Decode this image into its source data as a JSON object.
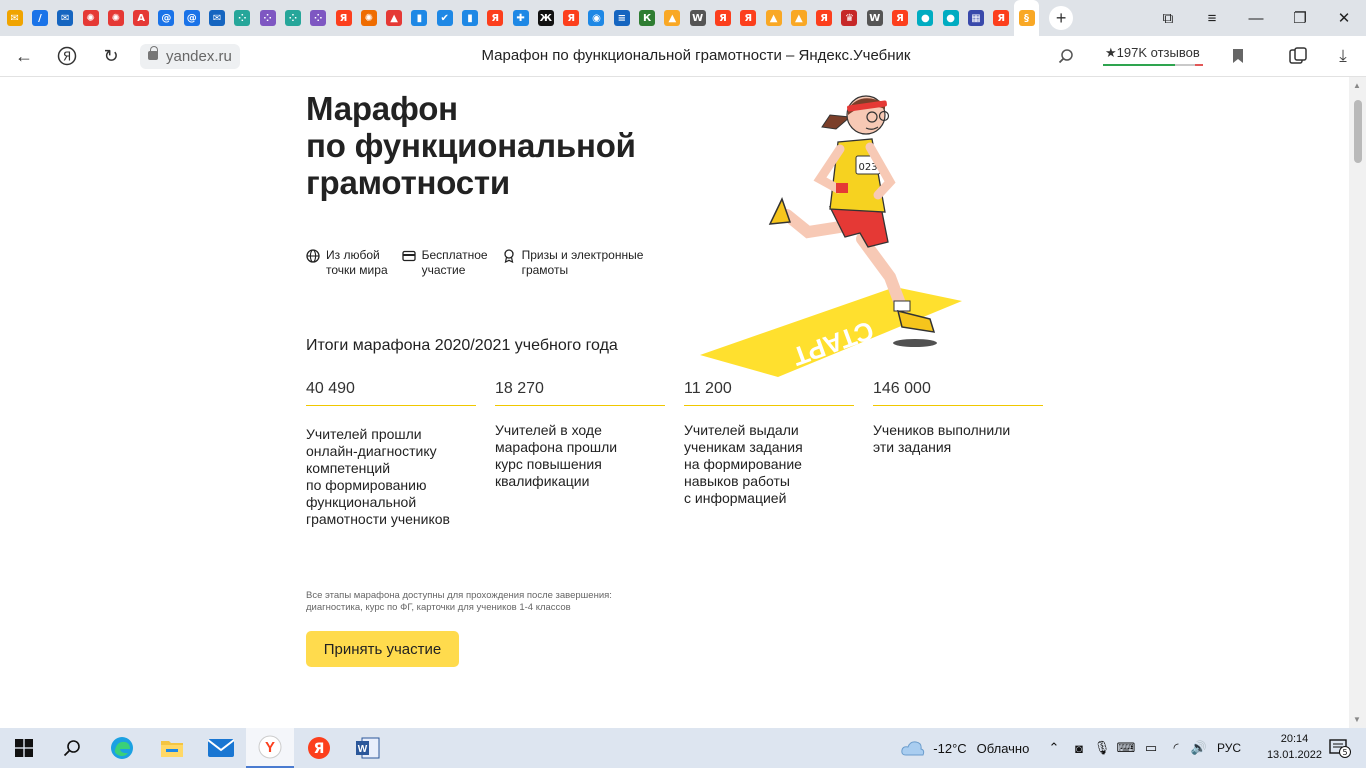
{
  "browser": {
    "tabs": [
      {
        "icon": "mail-icon",
        "color": "#f0a400",
        "glyph": "✉"
      },
      {
        "icon": "edit-icon",
        "color": "#1a73e8",
        "glyph": "/"
      },
      {
        "icon": "mail-icon",
        "color": "#1565c0",
        "glyph": "✉"
      },
      {
        "icon": "ornament-icon",
        "color": "#e53935",
        "glyph": "✺"
      },
      {
        "icon": "ornament-icon",
        "color": "#e53935",
        "glyph": "✺"
      },
      {
        "icon": "pdf-icon",
        "color": "#e53935",
        "glyph": "A"
      },
      {
        "icon": "at-icon",
        "color": "#1a73e8",
        "glyph": "@"
      },
      {
        "icon": "at-icon",
        "color": "#1a73e8",
        "glyph": "@"
      },
      {
        "icon": "mail-icon",
        "color": "#1565c0",
        "glyph": "✉"
      },
      {
        "icon": "dots-icon",
        "color": "#26a69a",
        "glyph": "⁘"
      },
      {
        "icon": "dots-icon",
        "color": "#7e57c2",
        "glyph": "⁘"
      },
      {
        "icon": "dots-icon",
        "color": "#26a69a",
        "glyph": "⁘"
      },
      {
        "icon": "dots-icon",
        "color": "#7e57c2",
        "glyph": "⁘"
      },
      {
        "icon": "yandex-icon",
        "color": "#fc3f1d",
        "glyph": "Я"
      },
      {
        "icon": "ornament-icon",
        "color": "#ef6c00",
        "glyph": "✺"
      },
      {
        "icon": "rocket-icon",
        "color": "#e53935",
        "glyph": "▲"
      },
      {
        "icon": "book-icon",
        "color": "#1e88e5",
        "glyph": "▮"
      },
      {
        "icon": "check-icon",
        "color": "#1e88e5",
        "glyph": "✔"
      },
      {
        "icon": "book-icon",
        "color": "#1e88e5",
        "glyph": "▮"
      },
      {
        "icon": "yandex-icon",
        "color": "#fc3f1d",
        "glyph": "Я"
      },
      {
        "icon": "cross-icon",
        "color": "#1e88e5",
        "glyph": "✚"
      },
      {
        "icon": "z-icon",
        "color": "#111111",
        "glyph": "Ж"
      },
      {
        "icon": "yandex-icon",
        "color": "#fc3f1d",
        "glyph": "Я"
      },
      {
        "icon": "globe-icon",
        "color": "#1e88e5",
        "glyph": "◉"
      },
      {
        "icon": "rfs-icon",
        "color": "#1565c0",
        "glyph": "≡"
      },
      {
        "icon": "kc-icon",
        "color": "#2e7d32",
        "glyph": "К"
      },
      {
        "icon": "mountain-icon",
        "color": "#f9a825",
        "glyph": "▲"
      },
      {
        "icon": "wikipedia-icon",
        "color": "#555555",
        "glyph": "W"
      },
      {
        "icon": "yandex-icon",
        "color": "#fc3f1d",
        "glyph": "Я"
      },
      {
        "icon": "yandex-icon",
        "color": "#fc3f1d",
        "glyph": "Я"
      },
      {
        "icon": "mountain-icon",
        "color": "#f9a825",
        "glyph": "▲"
      },
      {
        "icon": "mountain-icon",
        "color": "#f9a825",
        "glyph": "▲"
      },
      {
        "icon": "yandex-icon",
        "color": "#fc3f1d",
        "glyph": "Я"
      },
      {
        "icon": "emblem-icon",
        "color": "#c62828",
        "glyph": "♛"
      },
      {
        "icon": "wikipedia-icon",
        "color": "#555555",
        "glyph": "W"
      },
      {
        "icon": "yandex-icon",
        "color": "#fc3f1d",
        "glyph": "Я"
      },
      {
        "icon": "circle-icon",
        "color": "#00acc1",
        "glyph": "●"
      },
      {
        "icon": "circle-icon",
        "color": "#00acc1",
        "glyph": "●"
      },
      {
        "icon": "grid-icon",
        "color": "#3949ab",
        "glyph": "▦"
      },
      {
        "icon": "yandex-icon",
        "color": "#fc3f1d",
        "glyph": "Я"
      },
      {
        "icon": "section-icon",
        "color": "#f9a825",
        "glyph": "§"
      }
    ],
    "active_tab_index": 40,
    "url": "yandex.ru",
    "page_title": "Марафон по функциональной грамотности – Яндекс.Учебник",
    "reviews": "★197K отзывов"
  },
  "page": {
    "title_lines": [
      "Марафон",
      "по функциональной",
      "грамотности"
    ],
    "features": [
      {
        "icon": "globe-icon",
        "line1": "Из любой",
        "line2": "точки мира"
      },
      {
        "icon": "card-icon",
        "line1": "Бесплатное",
        "line2": "участие"
      },
      {
        "icon": "award-icon",
        "line1": "Призы и электронные",
        "line2": "грамоты"
      }
    ],
    "results_title": "Итоги марафона 2020/2021 учебного года",
    "stats": [
      {
        "num": "40 490",
        "desc": [
          "Учителей прошли",
          "онлайн-диагностику",
          "компетенций",
          "по формированию",
          "функциональной",
          "грамотности учеников"
        ]
      },
      {
        "num": "18 270",
        "desc": [
          "Учителей в ходе",
          "марафона прошли",
          "курс повышения",
          "квалификации"
        ]
      },
      {
        "num": "11 200",
        "desc": [
          "Учителей выдали",
          "ученикам задания",
          "на формирование",
          "навыков работы",
          "с информацией"
        ]
      },
      {
        "num": "146 000",
        "desc": [
          "Учеников выполнили",
          "эти задания"
        ]
      }
    ],
    "note_lines": [
      "Все этапы марафона доступны для прохождения после завершения:",
      "диагностика, курс по ФГ, карточки для учеников 1-4 классов"
    ],
    "cta_label": "Принять участие",
    "illustration": {
      "bib_number": "023",
      "start_text": "СТАРТ"
    }
  },
  "taskbar": {
    "weather_temp": "-12°C",
    "weather_text": "Облачно",
    "language": "РУС",
    "time": "20:14",
    "date": "13.01.2022",
    "notifications": "5"
  }
}
